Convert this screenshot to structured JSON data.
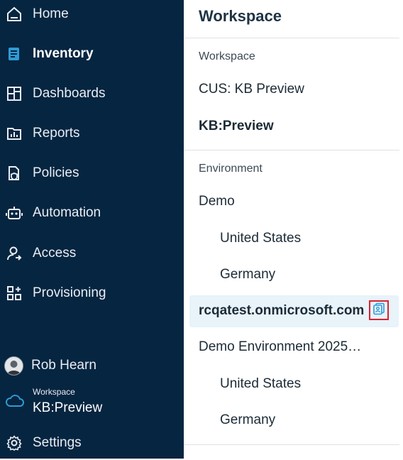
{
  "sidebar": {
    "items": [
      {
        "label": "Home",
        "icon": "home-icon"
      },
      {
        "label": "Inventory",
        "icon": "inventory-icon",
        "active": true
      },
      {
        "label": "Dashboards",
        "icon": "dashboards-icon"
      },
      {
        "label": "Reports",
        "icon": "reports-icon"
      },
      {
        "label": "Policies",
        "icon": "policies-icon"
      },
      {
        "label": "Automation",
        "icon": "automation-icon"
      },
      {
        "label": "Access",
        "icon": "access-icon"
      },
      {
        "label": "Provisioning",
        "icon": "provisioning-icon"
      }
    ],
    "user": {
      "name": "Rob Hearn"
    },
    "workspace": {
      "caption": "Workspace",
      "name": "KB:Preview"
    },
    "settings": {
      "label": "Settings"
    }
  },
  "panel": {
    "title": "Workspace",
    "workspace_section": {
      "label": "Workspace",
      "items": [
        "CUS: KB Preview",
        "KB:Preview"
      ]
    },
    "environment_section": {
      "label": "Environment",
      "items": [
        {
          "label": "Demo"
        },
        {
          "label": "United States"
        },
        {
          "label": "Germany"
        },
        {
          "label": "rcqatest.onmicrosoft.com"
        },
        {
          "label": "Demo Environment 2025…"
        },
        {
          "label": "United States"
        },
        {
          "label": "Germany"
        }
      ]
    }
  },
  "colors": {
    "sidebar_bg": "#062540",
    "accent": "#2e9bd6",
    "selected_bg": "#e8f3fa",
    "highlight_border": "#d9232e"
  }
}
